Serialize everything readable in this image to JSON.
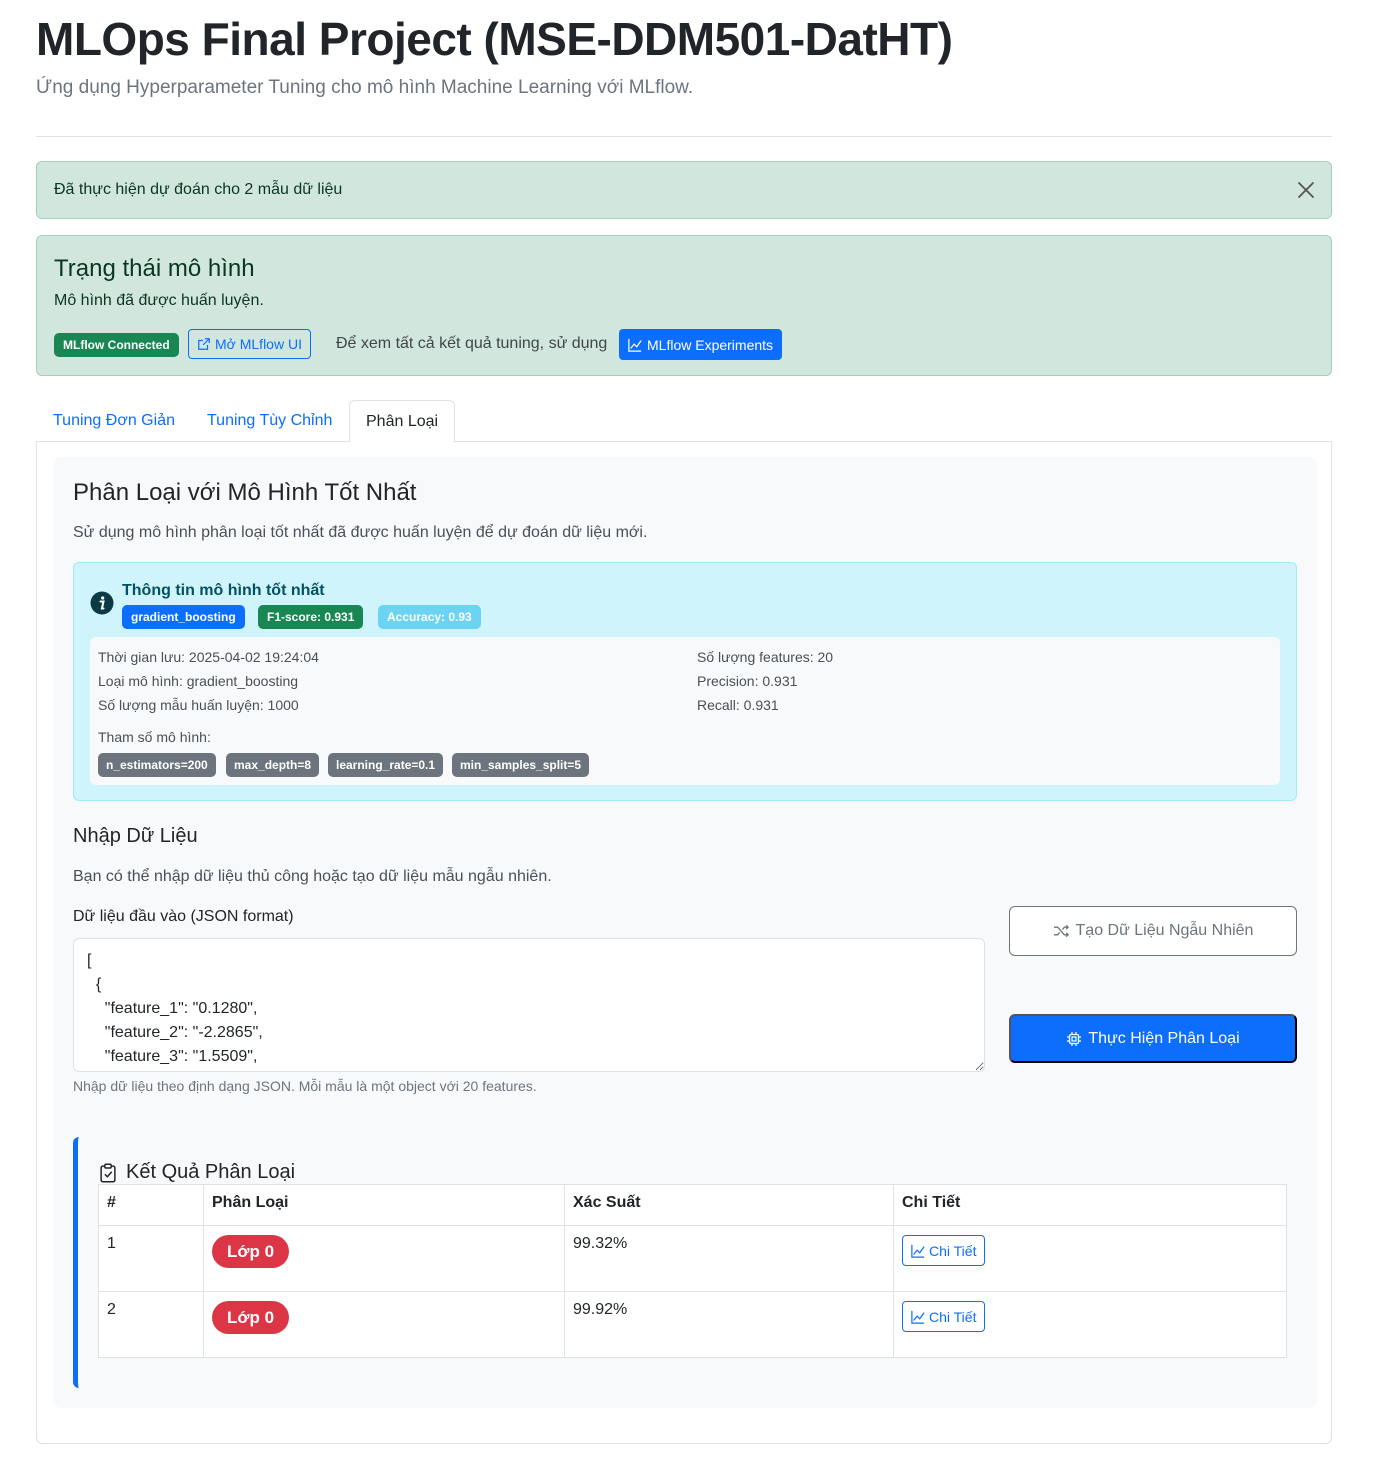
{
  "header": {
    "title": "MLOps Final Project (MSE-DDM501-DatHT)",
    "subtitle": "Ứng dụng Hyperparameter Tuning cho mô hình Machine Learning với MLflow."
  },
  "alert": {
    "text": "Đã thực hiện dự đoán cho 2 mẫu dữ liệu",
    "close_icon": "close-icon"
  },
  "model_status": {
    "title": "Trạng thái mô hình",
    "text": "Mô hình đã được huấn luyện.",
    "mlflow_badge": "MLflow Connected",
    "open_mlflow_label": "Mở MLflow UI",
    "hint": "Để xem tất cả kết quả tuning, sử dụng",
    "experiments_label": "MLflow Experiments"
  },
  "tabs": [
    {
      "label": "Tuning Đơn Giản",
      "active": false
    },
    {
      "label": "Tuning Tùy Chỉnh",
      "active": false
    },
    {
      "label": "Phân Loại",
      "active": true
    }
  ],
  "classify": {
    "title": "Phân Loại với Mô Hình Tốt Nhất",
    "desc": "Sử dụng mô hình phân loại tốt nhất đã được huấn luyện để dự đoán dữ liệu mới.",
    "best_model": {
      "title": "Thông tin mô hình tốt nhất",
      "badges": {
        "model": "gradient_boosting",
        "f1": "F1-score: 0.931",
        "accuracy": "Accuracy: 0.93"
      },
      "saved_time": "Thời gian lưu: 2025-04-02 19:24:04",
      "model_type": "Loại mô hình: gradient_boosting",
      "n_samples": "Số lượng mẫu huấn luyện: 1000",
      "n_features": "Số lượng features: 20",
      "precision": "Precision: 0.931",
      "recall": "Recall: 0.931",
      "params_label": "Tham số mô hình:",
      "params": [
        "n_estimators=200",
        "max_depth=8",
        "learning_rate=0.1",
        "min_samples_split=5"
      ]
    },
    "input": {
      "title": "Nhập Dữ Liệu",
      "desc": "Bạn có thể nhập dữ liệu thủ công hoặc tạo dữ liệu mẫu ngẫu nhiên.",
      "label": "Dữ liệu đầu vào (JSON format)",
      "value": "[\n  {\n    \"feature_1\": \"0.1280\",\n    \"feature_2\": \"-2.2865\",\n    \"feature_3\": \"1.5509\",",
      "help": "Nhập dữ liệu theo định dạng JSON. Mỗi mẫu là một object với 20 features.",
      "random_label": "Tạo Dữ Liệu Ngẫu Nhiên",
      "classify_label": "Thực Hiện Phân Loại"
    },
    "results": {
      "title": "Kết Quả Phân Loại",
      "columns": [
        "#",
        "Phân Loại",
        "Xác Suất",
        "Chi Tiết"
      ],
      "rows": [
        {
          "idx": "1",
          "class": "Lớp 0",
          "prob": "99.32%",
          "detail": "Chi Tiết"
        },
        {
          "idx": "2",
          "class": "Lớp 0",
          "prob": "99.92%",
          "detail": "Chi Tiết"
        }
      ]
    }
  },
  "colors": {
    "primary": "#0d6efd",
    "success": "#198754",
    "danger": "#dc3545",
    "info_bg": "#cff4fc",
    "success_bg": "#d1e7dd"
  }
}
